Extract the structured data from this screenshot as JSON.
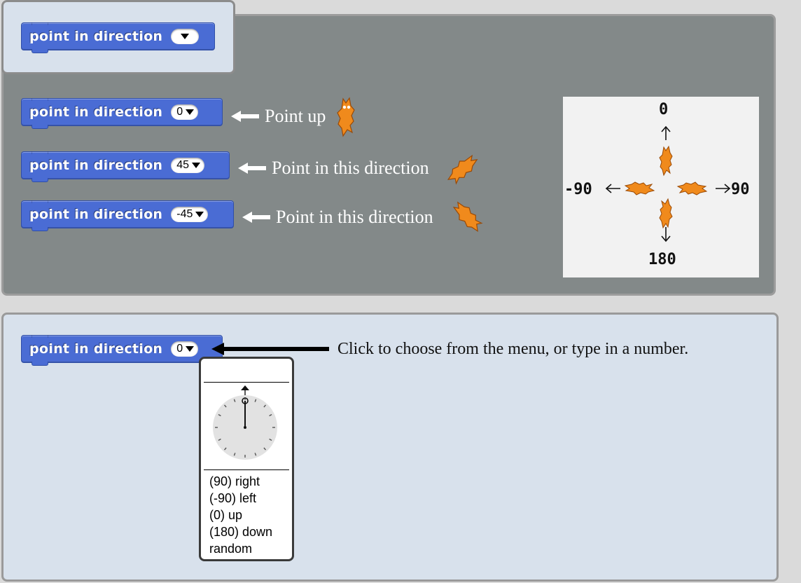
{
  "blocks": {
    "block_label": "point in direction",
    "top_block": {
      "value": ""
    },
    "up_block": {
      "value": "0"
    },
    "right45_block": {
      "value": "45"
    },
    "left45_block": {
      "value": "-45"
    },
    "menu_block": {
      "value": "0"
    }
  },
  "annotations": {
    "point_up": "Point up",
    "point_this_direction_1": "Point in this direction",
    "point_this_direction_2": "Point in this direction",
    "click_hint": "Click to choose from the menu, or type in a number."
  },
  "diagram": {
    "top": "0",
    "bottom": "180",
    "left": "-90",
    "right": "90"
  },
  "menu": {
    "items": [
      "(90) right",
      "(-90) left",
      "(0) up",
      "(180) down",
      "random"
    ]
  },
  "colors": {
    "block": "#4a6cd4",
    "panel_gray": "#838989",
    "panel_light": "#d8e1ec",
    "sprite_orange": "#f08a1c"
  },
  "icons": [
    "sprite-cat-icon",
    "left-arrow-icon",
    "dial-icon"
  ]
}
